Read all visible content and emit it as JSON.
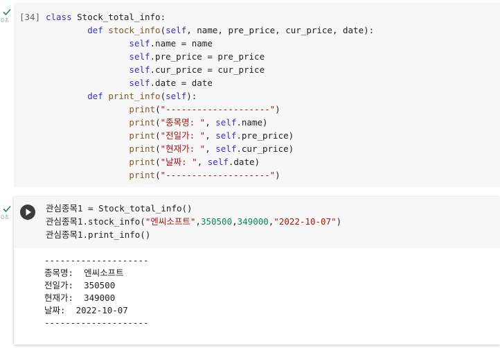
{
  "cell1": {
    "exec_count": "[34]",
    "exec_time": "0초",
    "code_lines": [
      [
        {
          "t": "class ",
          "c": "kw"
        },
        {
          "t": "Stock_total_info:",
          "c": ""
        }
      ],
      [
        {
          "t": "        ",
          "c": ""
        },
        {
          "t": "def ",
          "c": "kw"
        },
        {
          "t": "stock_info",
          "c": "fn"
        },
        {
          "t": "(",
          "c": ""
        },
        {
          "t": "self",
          "c": "self"
        },
        {
          "t": ", name, pre_price, cur_price, date):",
          "c": ""
        }
      ],
      [
        {
          "t": "                ",
          "c": ""
        },
        {
          "t": "self",
          "c": "self"
        },
        {
          "t": ".name = name",
          "c": ""
        }
      ],
      [
        {
          "t": "                ",
          "c": ""
        },
        {
          "t": "self",
          "c": "self"
        },
        {
          "t": ".pre_price = pre_price",
          "c": ""
        }
      ],
      [
        {
          "t": "                ",
          "c": ""
        },
        {
          "t": "self",
          "c": "self"
        },
        {
          "t": ".cur_price = cur_price",
          "c": ""
        }
      ],
      [
        {
          "t": "                ",
          "c": ""
        },
        {
          "t": "self",
          "c": "self"
        },
        {
          "t": ".date = date",
          "c": ""
        }
      ],
      [
        {
          "t": "        ",
          "c": ""
        },
        {
          "t": "def ",
          "c": "kw"
        },
        {
          "t": "print_info",
          "c": "fn"
        },
        {
          "t": "(",
          "c": ""
        },
        {
          "t": "self",
          "c": "self"
        },
        {
          "t": "):",
          "c": ""
        }
      ],
      [
        {
          "t": "                ",
          "c": ""
        },
        {
          "t": "print",
          "c": "fn"
        },
        {
          "t": "(",
          "c": ""
        },
        {
          "t": "\"--------------------\"",
          "c": "str"
        },
        {
          "t": ")",
          "c": ""
        }
      ],
      [
        {
          "t": "                ",
          "c": ""
        },
        {
          "t": "print",
          "c": "fn"
        },
        {
          "t": "(",
          "c": ""
        },
        {
          "t": "\"종목명: \"",
          "c": "str"
        },
        {
          "t": ", ",
          "c": ""
        },
        {
          "t": "self",
          "c": "self"
        },
        {
          "t": ".name)",
          "c": ""
        }
      ],
      [
        {
          "t": "                ",
          "c": ""
        },
        {
          "t": "print",
          "c": "fn"
        },
        {
          "t": "(",
          "c": ""
        },
        {
          "t": "\"전일가: \"",
          "c": "str"
        },
        {
          "t": ", ",
          "c": ""
        },
        {
          "t": "self",
          "c": "self"
        },
        {
          "t": ".pre_price)",
          "c": ""
        }
      ],
      [
        {
          "t": "                ",
          "c": ""
        },
        {
          "t": "print",
          "c": "fn"
        },
        {
          "t": "(",
          "c": ""
        },
        {
          "t": "\"현재가: \"",
          "c": "str"
        },
        {
          "t": ", ",
          "c": ""
        },
        {
          "t": "self",
          "c": "self"
        },
        {
          "t": ".cur_price)",
          "c": ""
        }
      ],
      [
        {
          "t": "                ",
          "c": ""
        },
        {
          "t": "print",
          "c": "fn"
        },
        {
          "t": "(",
          "c": ""
        },
        {
          "t": "\"날짜: \"",
          "c": "str"
        },
        {
          "t": ", ",
          "c": ""
        },
        {
          "t": "self",
          "c": "self"
        },
        {
          "t": ".date)",
          "c": ""
        }
      ],
      [
        {
          "t": "                ",
          "c": ""
        },
        {
          "t": "print",
          "c": "fn"
        },
        {
          "t": "(",
          "c": ""
        },
        {
          "t": "\"--------------------\"",
          "c": "str"
        },
        {
          "t": ")",
          "c": ""
        }
      ]
    ]
  },
  "cell2": {
    "exec_time": "0초",
    "code_lines": [
      [
        {
          "t": "관심종목1 = Stock_total_info()",
          "c": ""
        }
      ],
      [
        {
          "t": "관심종목1.stock_info(",
          "c": ""
        },
        {
          "t": "\"엔씨소프트\"",
          "c": "str"
        },
        {
          "t": ",",
          "c": ""
        },
        {
          "t": "350500",
          "c": "num"
        },
        {
          "t": ",",
          "c": ""
        },
        {
          "t": "349000",
          "c": "num"
        },
        {
          "t": ",",
          "c": ""
        },
        {
          "t": "\"2022-10-07\"",
          "c": "str"
        },
        {
          "t": ")",
          "c": ""
        }
      ],
      [
        {
          "t": "관심종목1.print_info()",
          "c": ""
        }
      ]
    ],
    "output_lines": [
      "--------------------",
      "종목명:  엔씨소프트",
      "전일가:  350500",
      "현재가:  349000",
      "날짜:  2022-10-07",
      "--------------------"
    ]
  },
  "colors": {
    "keyword": "#3b2fc2",
    "function": "#795e26",
    "string": "#a31515",
    "number": "#098658",
    "check": "#1e8e3e",
    "cell_background": "#f7f7f7"
  },
  "icons": {
    "check": "check-icon",
    "run": "play-icon"
  }
}
